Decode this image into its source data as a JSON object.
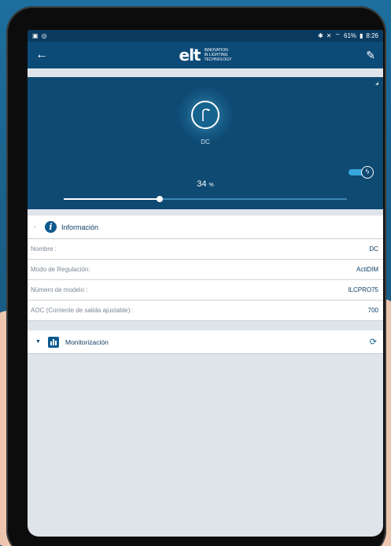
{
  "status_bar": {
    "left_icons": [
      "gallery-icon",
      "whatsapp-icon"
    ],
    "right_icons": [
      "bluetooth-icon",
      "mute-icon",
      "wifi-icon",
      "battery-icon"
    ],
    "battery": "61%",
    "time": "8:26"
  },
  "app_bar": {
    "back_icon": "←",
    "logo_text": "elt",
    "logo_tagline": [
      "INNOVATION",
      "IN LIGHTING",
      "TECHNOLOGY"
    ],
    "edit_icon": "✎"
  },
  "device": {
    "name_label": "DC",
    "dim_level": "34",
    "dim_unit": "%",
    "slider_fraction": 0.34,
    "power_on": true
  },
  "info": {
    "title": "Información",
    "rows": [
      {
        "label": "Nombre :",
        "value": "DC"
      },
      {
        "label": "Modo de Regulación:",
        "value": "ActiDIM"
      },
      {
        "label": "Número de modelo :",
        "value": "ILCPRO75"
      },
      {
        "label": "AOC (Corriente de salida ajustable):",
        "value": "700"
      }
    ]
  },
  "monitoring": {
    "title": "Monitorización"
  },
  "colors": {
    "header": "#0c4a77",
    "hero": "#0e4a72",
    "accent": "#36a6dd"
  }
}
